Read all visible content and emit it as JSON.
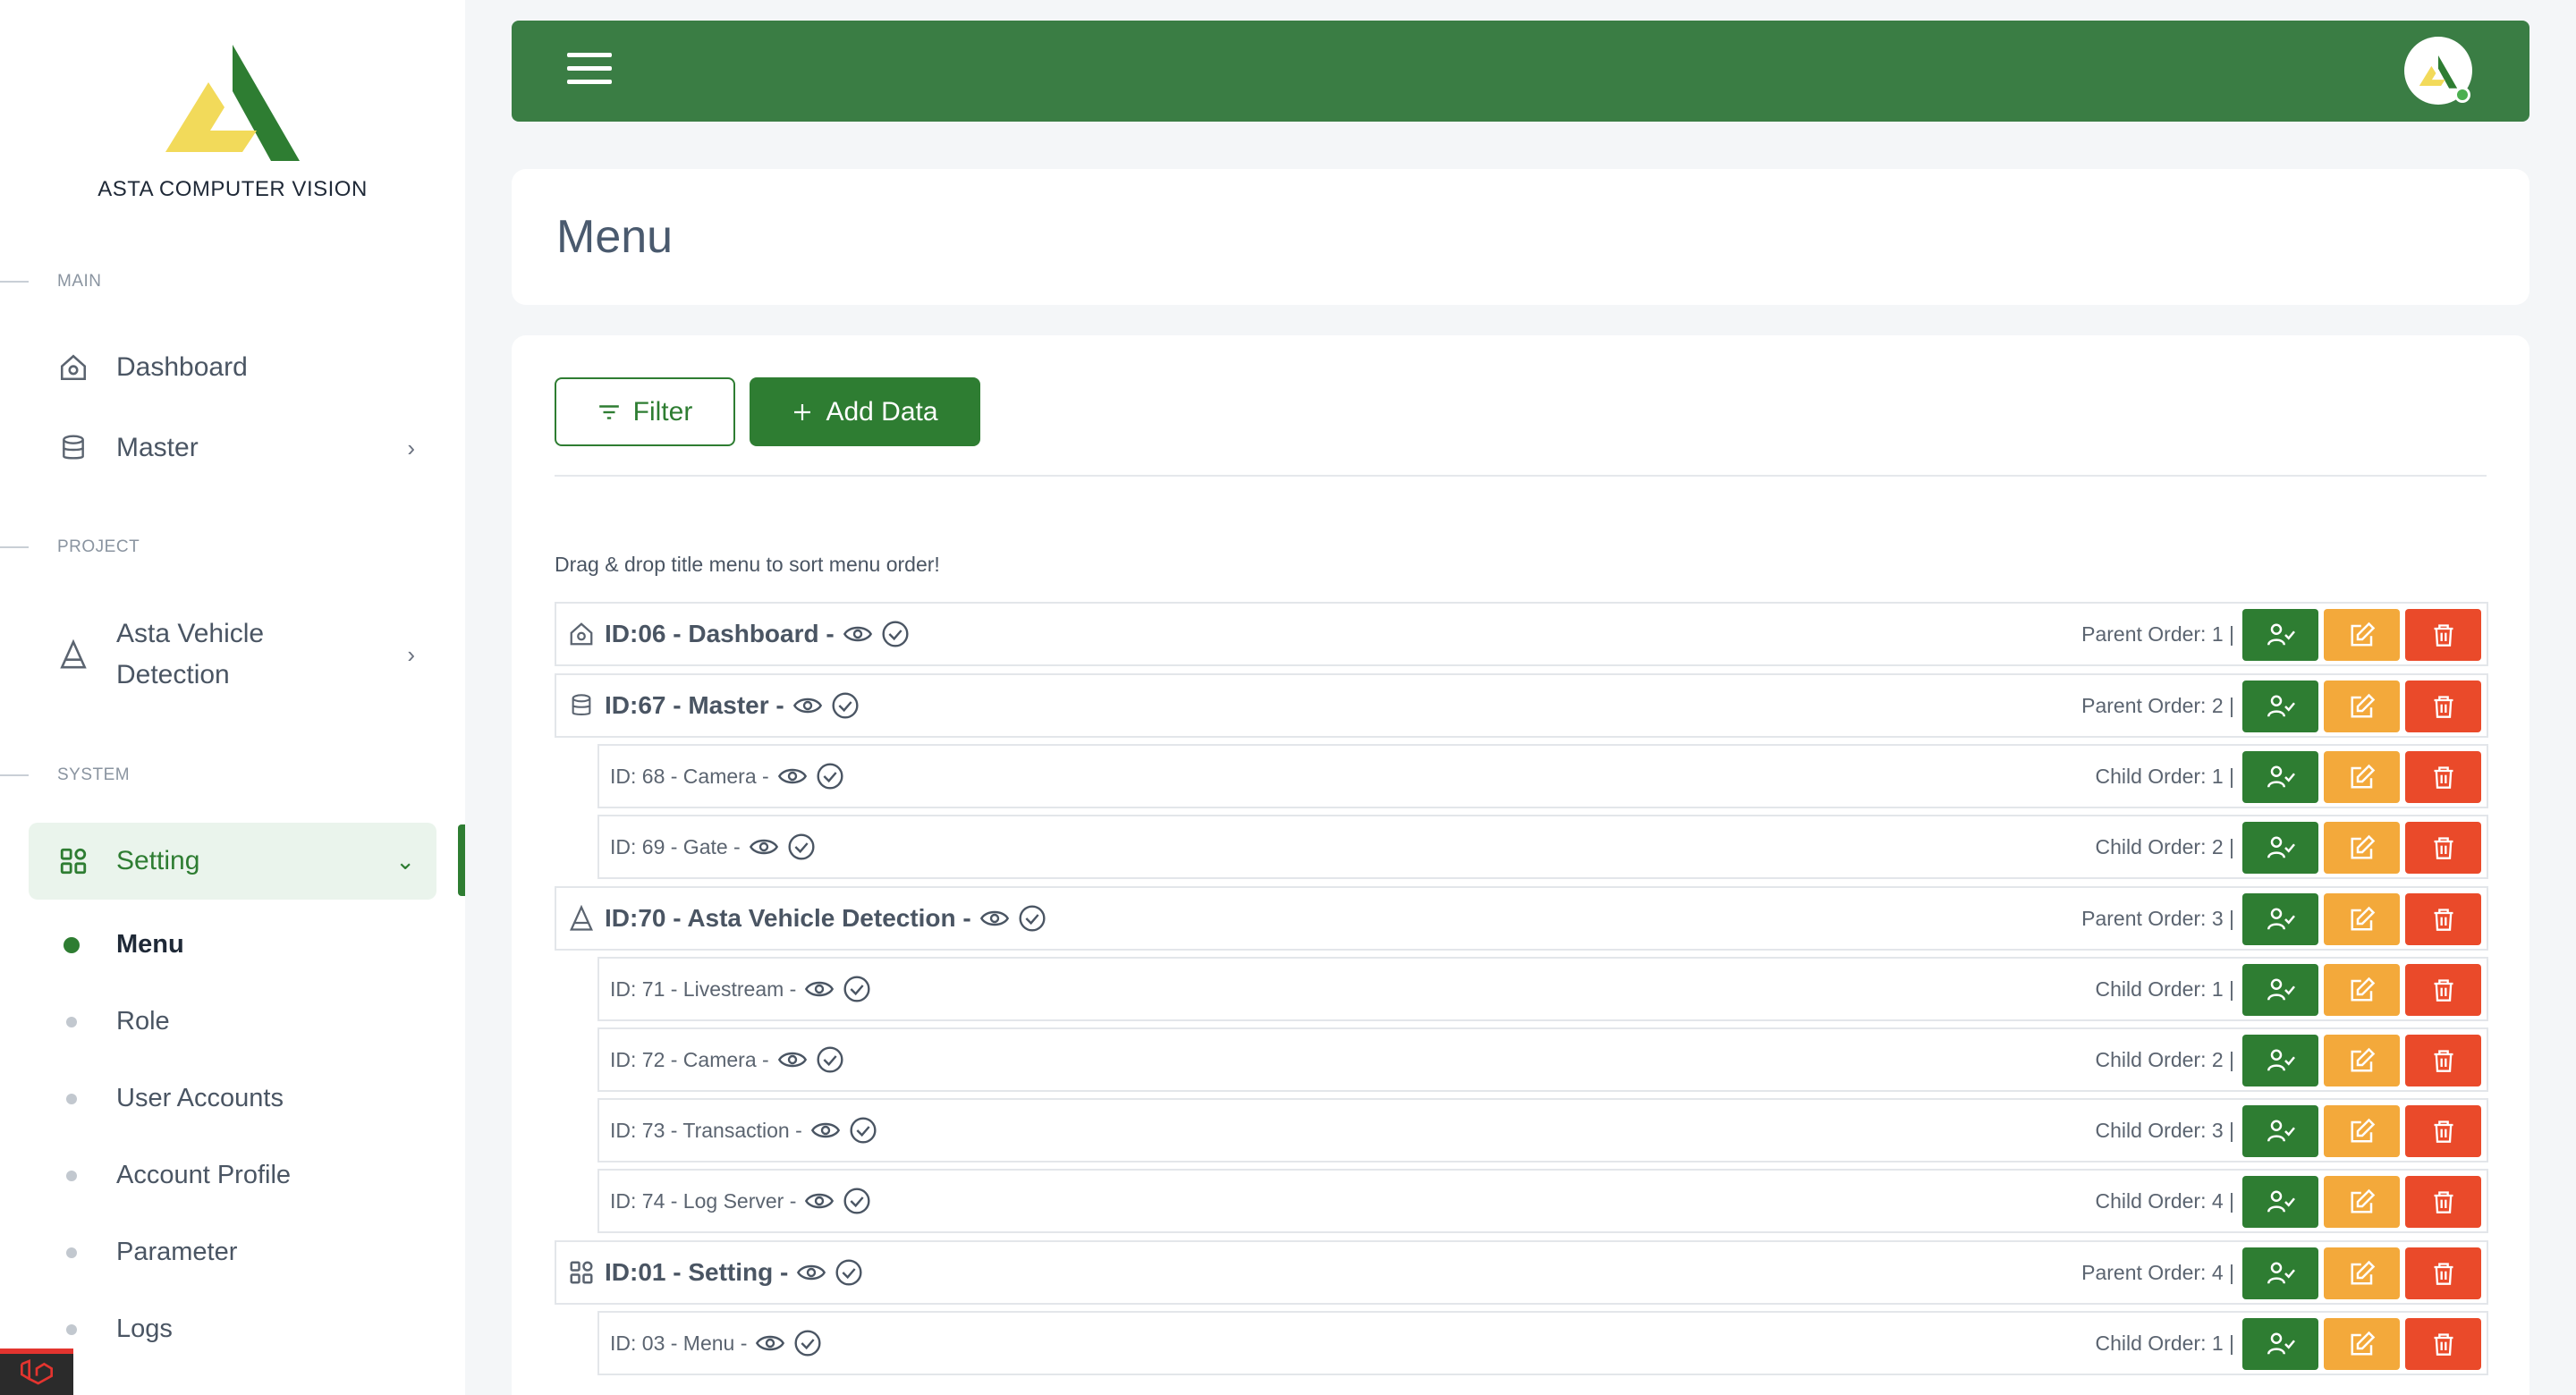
{
  "brand": {
    "name": "ASTA COMPUTER VISION"
  },
  "sidebar": {
    "sections": {
      "main": "MAIN",
      "project": "PROJECT",
      "system": "SYSTEM"
    },
    "items": {
      "dashboard": "Dashboard",
      "master": "Master",
      "asta_line1": "Asta Vehicle",
      "asta_line2": "Detection",
      "setting": "Setting"
    },
    "sub_items": [
      "Menu",
      "Role",
      "User Accounts",
      "Account Profile",
      "Parameter",
      "Logs"
    ]
  },
  "page": {
    "title": "Menu"
  },
  "toolbar": {
    "filter_label": "Filter",
    "add_label": "Add Data"
  },
  "hint": "Drag & drop title menu to sort menu order!",
  "menu_rows": [
    {
      "type": "parent",
      "icon": "home-icon",
      "label": "ID:06 - Dashboard -",
      "order": "Parent Order: 1 |"
    },
    {
      "type": "parent",
      "icon": "database-icon",
      "label": "ID:67 - Master -",
      "order": "Parent Order: 2 |"
    },
    {
      "type": "child",
      "label": "ID: 68 - Camera -",
      "order": "Child Order: 1 |"
    },
    {
      "type": "child",
      "label": "ID: 69 - Gate -",
      "order": "Child Order: 2 |"
    },
    {
      "type": "parent",
      "icon": "asta-icon",
      "label": "ID:70 - Asta Vehicle Detection -",
      "order": "Parent Order: 3 |"
    },
    {
      "type": "child",
      "label": "ID: 71 - Livestream -",
      "order": "Child Order: 1 |"
    },
    {
      "type": "child",
      "label": "ID: 72 - Camera -",
      "order": "Child Order: 2 |"
    },
    {
      "type": "child",
      "label": "ID: 73 - Transaction -",
      "order": "Child Order: 3 |"
    },
    {
      "type": "child",
      "label": "ID: 74 - Log Server -",
      "order": "Child Order: 4 |"
    },
    {
      "type": "parent",
      "icon": "grid-icon",
      "label": "ID:01 - Setting -",
      "order": "Parent Order: 4 |"
    },
    {
      "type": "child",
      "label": "ID: 03 - Menu -",
      "order": "Child Order: 1 |"
    }
  ],
  "colors": {
    "primary": "#2e7d32",
    "topbar": "#3a7d44",
    "edit": "#f3a93b",
    "delete": "#ea4a2a",
    "logo_yellow": "#f2da5a"
  }
}
